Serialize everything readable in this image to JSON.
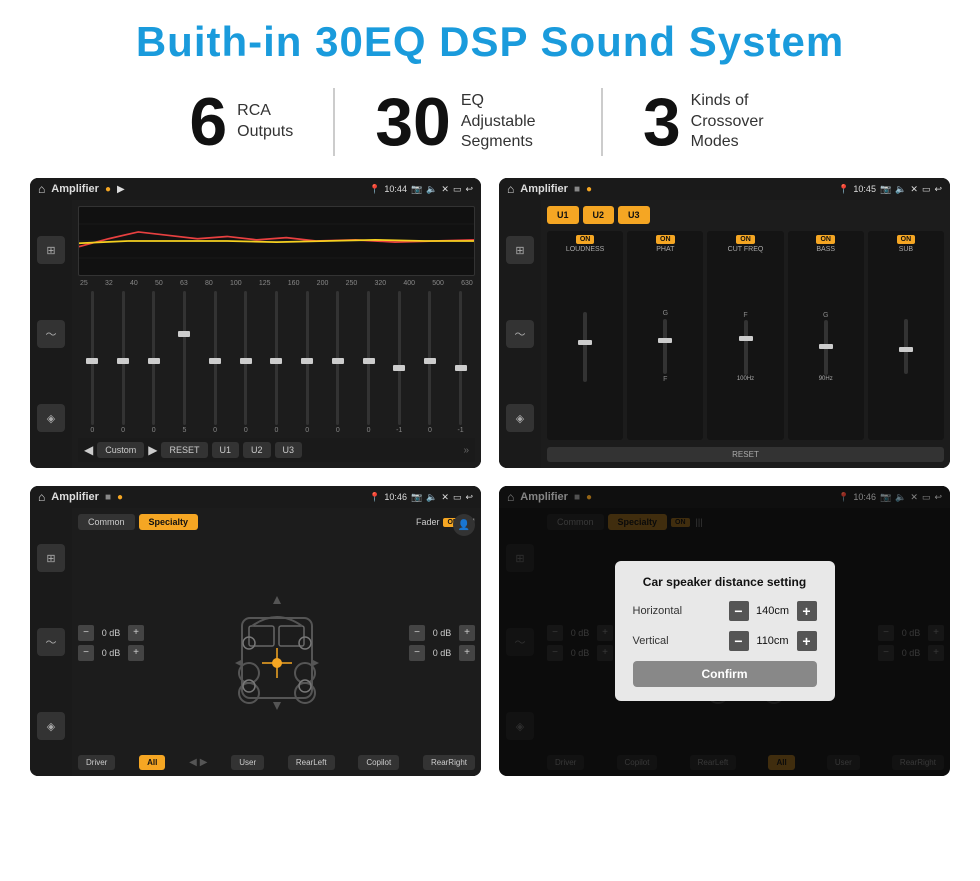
{
  "page": {
    "title": "Buith-in 30EQ DSP Sound System",
    "stats": [
      {
        "number": "6",
        "label": "RCA\nOutputs"
      },
      {
        "number": "30",
        "label": "EQ Adjustable\nSegments"
      },
      {
        "number": "3",
        "label": "Kinds of\nCrossover Modes"
      }
    ]
  },
  "screens": {
    "eq": {
      "topbar": {
        "title": "Amplifier",
        "time": "10:44"
      },
      "frequencies": [
        "25",
        "32",
        "40",
        "50",
        "63",
        "80",
        "100",
        "125",
        "160",
        "200",
        "250",
        "320",
        "400",
        "500",
        "630"
      ],
      "sliders": [
        0,
        0,
        0,
        5,
        0,
        0,
        0,
        0,
        0,
        0,
        -1,
        0,
        -1
      ],
      "bottom_buttons": [
        "Custom",
        "RESET",
        "U1",
        "U2",
        "U3"
      ]
    },
    "crossover": {
      "topbar": {
        "title": "Amplifier",
        "time": "10:45"
      },
      "units": [
        "U1",
        "U2",
        "U3"
      ],
      "controls": [
        {
          "label": "LOUDNESS",
          "on": true
        },
        {
          "label": "PHAT",
          "on": true
        },
        {
          "label": "CUT FREQ",
          "on": true
        },
        {
          "label": "BASS",
          "on": true
        },
        {
          "label": "SUB",
          "on": true
        }
      ],
      "reset": "RESET"
    },
    "fader": {
      "topbar": {
        "title": "Amplifier",
        "time": "10:46"
      },
      "tabs": [
        "Common",
        "Specialty"
      ],
      "active_tab": "Specialty",
      "fader_label": "Fader",
      "on": "ON",
      "db_values": [
        "0 dB",
        "0 dB",
        "0 dB",
        "0 dB"
      ],
      "bottom_buttons": [
        "Driver",
        "All",
        "User",
        "RearLeft",
        "Copilot",
        "RearRight"
      ]
    },
    "dialog_screen": {
      "topbar": {
        "title": "Amplifier",
        "time": "10:46"
      },
      "tabs": [
        "Common",
        "Specialty"
      ],
      "active_tab": "Specialty",
      "on": "ON",
      "dialog": {
        "title": "Car speaker distance setting",
        "fields": [
          {
            "label": "Horizontal",
            "value": "140cm"
          },
          {
            "label": "Vertical",
            "value": "110cm"
          }
        ],
        "confirm_btn": "Confirm"
      },
      "db_values": [
        "0 dB",
        "0 dB"
      ],
      "bottom_buttons": [
        "Driver",
        "Copilot",
        "RearLeft",
        "RearRight",
        "All",
        "User"
      ]
    }
  }
}
